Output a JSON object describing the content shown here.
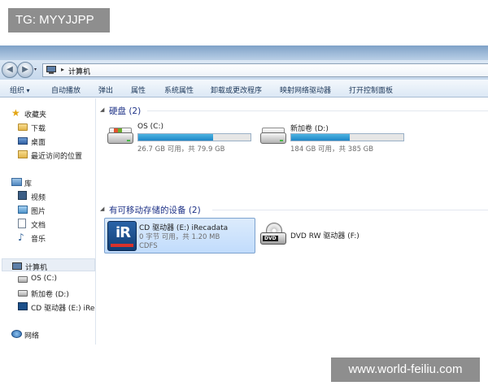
{
  "overlay_tag": "TG: MYYJJPP",
  "watermark": "www.world-feiliu.com",
  "address": {
    "separator": "▸",
    "location": "计算机"
  },
  "toolbar": {
    "organize": "组织",
    "autoplay": "自动播放",
    "eject": "弹出",
    "properties": "属性",
    "system_properties": "系统属性",
    "uninstall": "卸载或更改程序",
    "map_drive": "映射网络驱动器",
    "control_panel": "打开控制面板"
  },
  "sidebar": {
    "favorites": "收藏夹",
    "downloads": "下载",
    "desktop": "桌面",
    "recent": "最近访问的位置",
    "libraries": "库",
    "videos": "视频",
    "pictures": "图片",
    "documents": "文档",
    "music": "音乐",
    "computer": "计算机",
    "drive_c": "OS (C:)",
    "drive_d": "新加卷 (D:)",
    "drive_e": "CD 驱动器 (E:) iRecadata",
    "network": "网络"
  },
  "groups": {
    "hard_disks": {
      "arrow": "◢",
      "title": "硬盘 (2)"
    },
    "removable": {
      "arrow": "◢",
      "title": "有可移动存储的设备 (2)"
    }
  },
  "drives": {
    "c": {
      "name": "OS (C:)",
      "free_text": "26.7 GB 可用，共 79.9 GB",
      "used_fraction": 0.666
    },
    "d": {
      "name": "新加卷 (D:)",
      "free_text": "184 GB 可用，共 385 GB",
      "used_fraction": 0.522
    },
    "e": {
      "name": "CD 驱动器 (E:) iRecadata",
      "free_text": "0 字节 可用，共 1.20 MB",
      "filesystem": "CDFS",
      "logo_text": "iR"
    },
    "f": {
      "name": "DVD RW 驱动器 (F:)",
      "icon_text": "DVD"
    }
  },
  "icons": {
    "back": "◀",
    "forward": "▶",
    "dropdown": "▾",
    "favorites_star": "★",
    "music_note": "♪"
  }
}
